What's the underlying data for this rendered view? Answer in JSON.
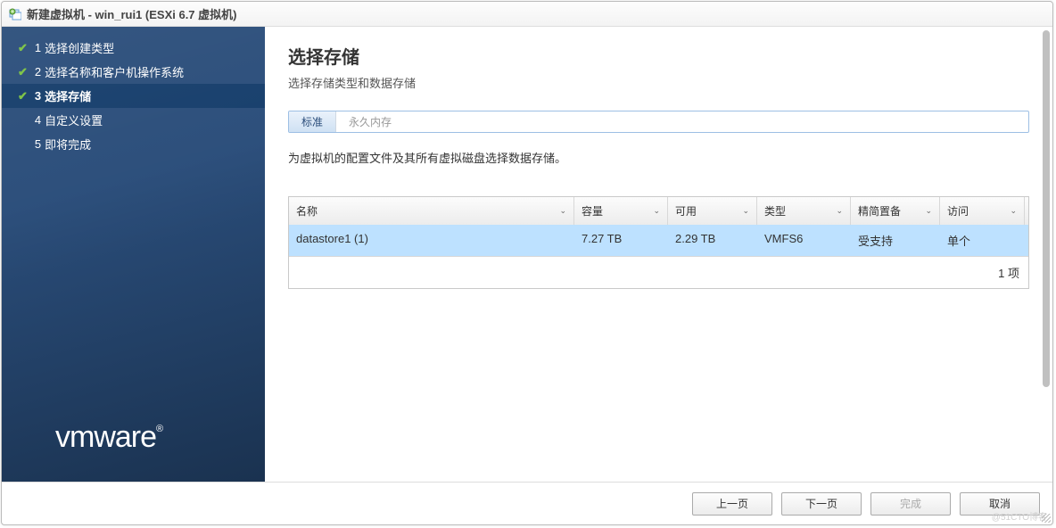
{
  "title": "新建虚拟机 - win_rui1 (ESXi 6.7 虚拟机)",
  "sidebar": {
    "steps": [
      {
        "num": "1",
        "label": "选择创建类型",
        "state": "done"
      },
      {
        "num": "2",
        "label": "选择名称和客户机操作系统",
        "state": "done"
      },
      {
        "num": "3",
        "label": "选择存储",
        "state": "active"
      },
      {
        "num": "4",
        "label": "自定义设置",
        "state": "pending"
      },
      {
        "num": "5",
        "label": "即将完成",
        "state": "pending"
      }
    ],
    "logo": "vmware",
    "logo_mark": "®"
  },
  "main": {
    "heading": "选择存储",
    "subheading": "选择存储类型和数据存储",
    "tabs": [
      {
        "label": "标准",
        "active": true
      },
      {
        "label": "永久内存",
        "active": false
      }
    ],
    "description": "为虚拟机的配置文件及其所有虚拟磁盘选择数据存储。",
    "table": {
      "headers": [
        "名称",
        "容量",
        "可用",
        "类型",
        "精简置备",
        "访问"
      ],
      "rows": [
        {
          "cells": [
            "datastore1 (1)",
            "7.27 TB",
            "2.29 TB",
            "VMFS6",
            "受支持",
            "单个"
          ],
          "selected": true
        }
      ],
      "footer": "1 项"
    }
  },
  "buttons": {
    "back": "上一页",
    "next": "下一页",
    "finish": "完成",
    "cancel": "取消"
  },
  "watermark": "@51CTO博客"
}
